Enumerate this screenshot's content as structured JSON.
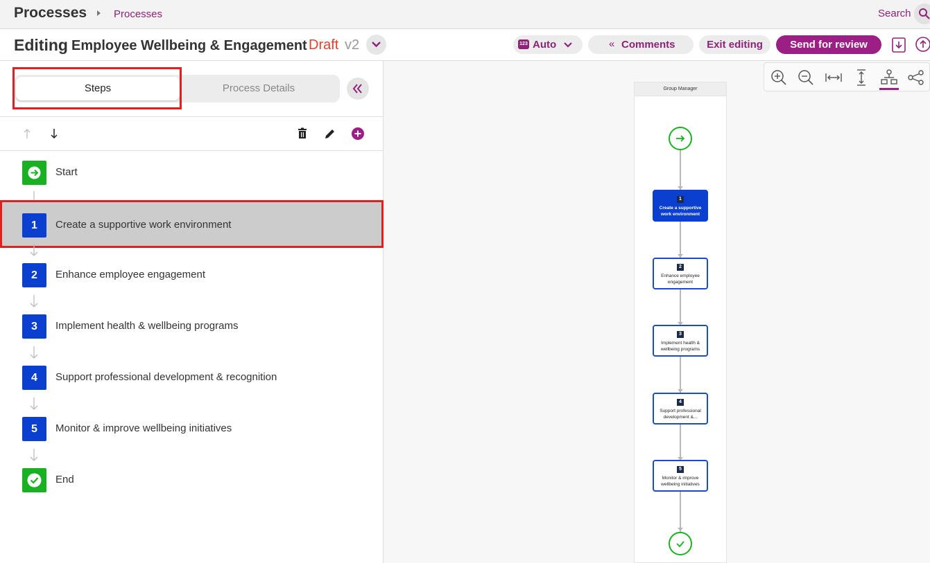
{
  "header": {
    "app_title": "Processes",
    "breadcrumb": "Processes",
    "search_label": "Search"
  },
  "editbar": {
    "editing_label": "Editing",
    "process_name": "Employee Wellbeing & Engagement",
    "status": "Draft",
    "version": "v2",
    "auto_badge": "123",
    "auto_label": "Auto",
    "comments_label": "Comments",
    "exit_label": "Exit editing",
    "review_label": "Send for review"
  },
  "tabs": {
    "steps": "Steps",
    "details": "Process Details"
  },
  "steps": [
    {
      "badge": "",
      "label": "Start",
      "type": "start"
    },
    {
      "badge": "1",
      "label": "Create a supportive work environment",
      "type": "step"
    },
    {
      "badge": "2",
      "label": "Enhance employee engagement",
      "type": "step"
    },
    {
      "badge": "3",
      "label": "Implement health & wellbeing programs",
      "type": "step"
    },
    {
      "badge": "4",
      "label": "Support professional development & recognition",
      "type": "step"
    },
    {
      "badge": "5",
      "label": "Monitor & improve wellbeing initiatives",
      "type": "step"
    },
    {
      "badge": "",
      "label": "End",
      "type": "end"
    }
  ],
  "diagram": {
    "lane_title": "Group Manager",
    "nodes": [
      {
        "num": "1",
        "text": "Create a supportive work environment"
      },
      {
        "num": "2",
        "text": "Enhance employee engagement"
      },
      {
        "num": "3",
        "text": "Implement health & wellbeing programs"
      },
      {
        "num": "4",
        "text": "Support professional development &..."
      },
      {
        "num": "5",
        "text": "Monitor & improve wellbeing initiatives"
      }
    ]
  },
  "colors": {
    "brand": "#9b1f84",
    "link": "#8e2278",
    "step_blue": "#0a3fcf",
    "start_end_green": "#19b022",
    "draft_red": "#e0422b",
    "highlight_red": "#e02020"
  }
}
